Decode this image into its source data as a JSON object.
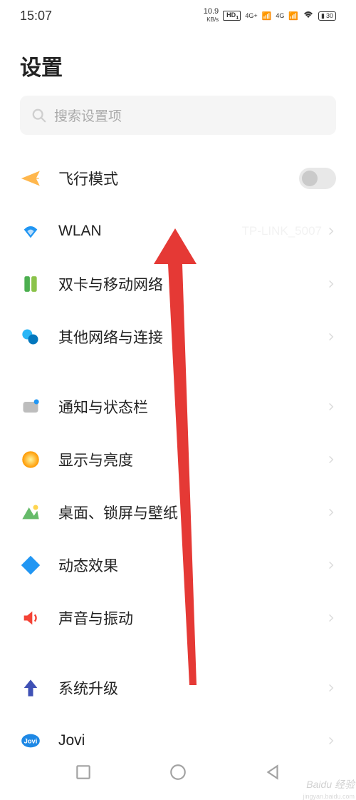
{
  "statusbar": {
    "time": "15:07",
    "speed": "10.9",
    "speed_unit": "KB/s",
    "hd": "HD",
    "sim1": "1",
    "sim2": "2",
    "signal1": "4G+",
    "signal2": "4G",
    "battery": "30"
  },
  "page_title": "设置",
  "search": {
    "placeholder": "搜索设置项"
  },
  "items": {
    "airplane": "飞行模式",
    "wlan": "WLAN",
    "wlan_value": "TP-LINK_5007",
    "dualsim": "双卡与移动网络",
    "other_network": "其他网络与连接",
    "notification": "通知与状态栏",
    "display": "显示与亮度",
    "desktop": "桌面、锁屏与壁纸",
    "effects": "动态效果",
    "sound": "声音与振动",
    "update": "系统升级",
    "jovi": "Jovi"
  },
  "watermark": "Baidu 经验",
  "watermark_sub": "jingyan.baidu.com"
}
